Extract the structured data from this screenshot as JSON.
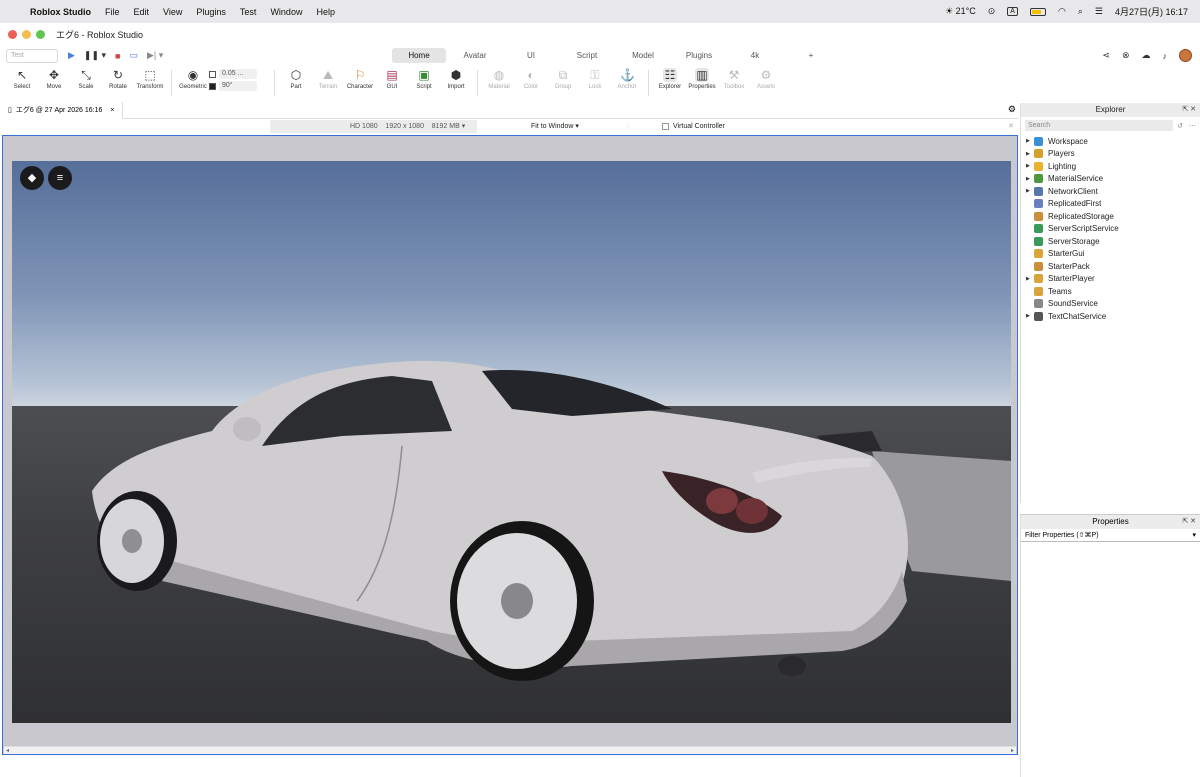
{
  "menubar": {
    "app_name": "Roblox Studio",
    "items": [
      "File",
      "Edit",
      "View",
      "Plugins",
      "Test",
      "Window",
      "Help"
    ],
    "weather": "☀ 21°C",
    "input_mode": "A",
    "datetime": "4月27日(月)  16:17"
  },
  "window": {
    "title": "エグ6 - Roblox Studio"
  },
  "ribbon": {
    "test_selector": "Test",
    "tabs": [
      {
        "label": "Home",
        "active": true
      },
      {
        "label": "Avatar",
        "active": false
      },
      {
        "label": "UI",
        "active": false
      },
      {
        "label": "Script",
        "active": false
      },
      {
        "label": "Model",
        "active": false
      },
      {
        "label": "Plugins",
        "active": false
      },
      {
        "label": "4k",
        "active": false
      },
      {
        "label": "+",
        "active": false
      }
    ]
  },
  "toolbar": {
    "select": "Select",
    "move": "Move",
    "scale": "Scale",
    "rotate": "Rotate",
    "transform": "Transform",
    "geometric": "Geometric",
    "snap_move": "0.05 ...",
    "snap_rotate": "90°",
    "part": "Part",
    "terrain": "Terrain",
    "character": "Character",
    "gui": "GUI",
    "script": "Script",
    "import": "Import",
    "material": "Material",
    "color": "Color",
    "group": "Group",
    "lock": "Lock",
    "anchor": "Anchor",
    "explorer": "Explorer",
    "properties": "Properties",
    "toolbox": "Toolbox",
    "assets": "Assets"
  },
  "document_tab": {
    "label": "エグ6 @ 27 Apr 2026 16:16",
    "close": "×"
  },
  "device_bar": {
    "device": "HD 1080",
    "resolution": "1920 x 1080",
    "memory": "8192 MB",
    "fit": "Fit to Window",
    "virtual_controller": "Virtual Controller"
  },
  "explorer": {
    "title": "Explorer",
    "search_placeholder": "Search",
    "items": [
      {
        "label": "Workspace",
        "expandable": true,
        "color": "#3a8fd9"
      },
      {
        "label": "Players",
        "expandable": true,
        "color": "#d6a12a"
      },
      {
        "label": "Lighting",
        "expandable": true,
        "color": "#e8b430"
      },
      {
        "label": "MaterialService",
        "expandable": true,
        "color": "#4c9a3c"
      },
      {
        "label": "NetworkClient",
        "expandable": true,
        "color": "#5577aa"
      },
      {
        "label": "ReplicatedFirst",
        "expandable": false,
        "color": "#6a7fbf"
      },
      {
        "label": "ReplicatedStorage",
        "expandable": false,
        "color": "#c98f3a"
      },
      {
        "label": "ServerScriptService",
        "expandable": false,
        "color": "#3a9a5a"
      },
      {
        "label": "ServerStorage",
        "expandable": false,
        "color": "#3a9a5a"
      },
      {
        "label": "StarterGui",
        "expandable": false,
        "color": "#d9a43a"
      },
      {
        "label": "StarterPack",
        "expandable": false,
        "color": "#c98f3a"
      },
      {
        "label": "StarterPlayer",
        "expandable": true,
        "color": "#d9a43a"
      },
      {
        "label": "Teams",
        "expandable": false,
        "color": "#d9a43a"
      },
      {
        "label": "SoundService",
        "expandable": false,
        "color": "#888888"
      },
      {
        "label": "TextChatService",
        "expandable": true,
        "color": "#555555"
      }
    ]
  },
  "properties": {
    "title": "Properties",
    "filter_placeholder": "Filter Properties (⇧⌘P)"
  }
}
